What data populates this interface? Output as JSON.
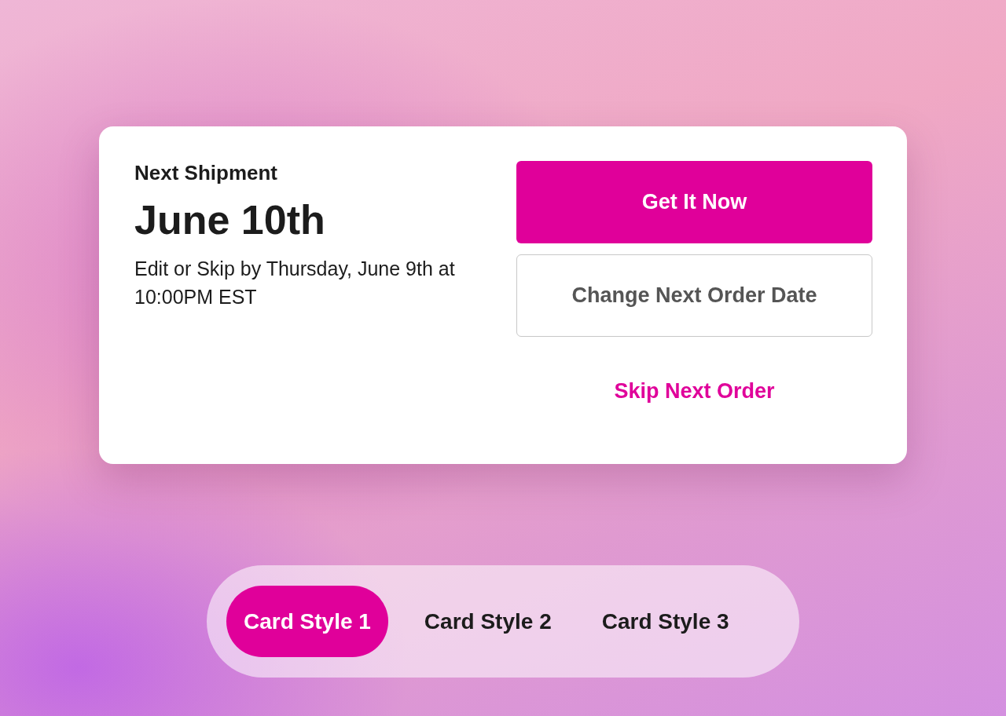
{
  "shipment": {
    "label": "Next Shipment",
    "date": "June 10th",
    "deadline": "Edit or Skip by Thursday, June 9th at 10:00PM EST"
  },
  "actions": [
    {
      "kind": "primary",
      "label": "Get It Now"
    },
    {
      "kind": "outline",
      "label": "Change Next Order Date"
    },
    {
      "kind": "link",
      "label": "Skip Next Order"
    }
  ],
  "tabs": [
    {
      "label": "Card Style 1",
      "selected": true
    },
    {
      "label": "Card Style 2",
      "selected": false
    },
    {
      "label": "Card Style 3",
      "selected": false
    }
  ]
}
